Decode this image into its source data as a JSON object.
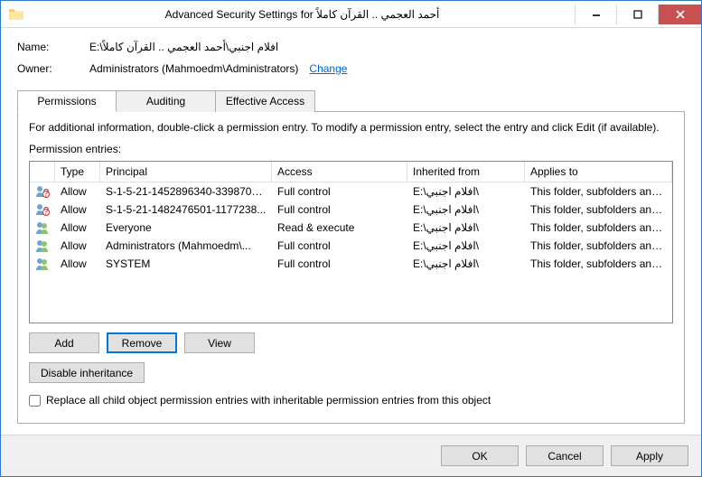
{
  "titlebar": {
    "title": "Advanced Security Settings for أحمد العجمي .. القرآن كاملاً"
  },
  "labels": {
    "name": "Name:",
    "owner": "Owner:"
  },
  "name_value": "E:\\افلام اجنبي\\أحمد العجمي .. القرآن كاملاً",
  "owner_value": "Administrators (Mahmoedm\\Administrators)",
  "change_link": "Change",
  "tabs": {
    "permissions": "Permissions",
    "auditing": "Auditing",
    "effective": "Effective Access"
  },
  "info_text": "For additional information, double-click a permission entry. To modify a permission entry, select the entry and click Edit (if available).",
  "entries_label": "Permission entries:",
  "headers": {
    "type": "Type",
    "principal": "Principal",
    "access": "Access",
    "inherited": "Inherited from",
    "applies": "Applies to"
  },
  "rows": [
    {
      "icon": "unknown",
      "type": "Allow",
      "principal": "S-1-5-21-1452896340-3398700...",
      "access": "Full control",
      "inherited": "E:\\افلام اجنبي\\",
      "applies": "This folder, subfolders and files"
    },
    {
      "icon": "unknown",
      "type": "Allow",
      "principal": "S-1-5-21-1482476501-1177238...",
      "access": "Full control",
      "inherited": "E:\\افلام اجنبي\\",
      "applies": "This folder, subfolders and files"
    },
    {
      "icon": "group",
      "type": "Allow",
      "principal": "Everyone",
      "access": "Read & execute",
      "inherited": "E:\\افلام اجنبي\\",
      "applies": "This folder, subfolders and files"
    },
    {
      "icon": "group",
      "type": "Allow",
      "principal": "Administrators (Mahmoedm\\...",
      "access": "Full control",
      "inherited": "E:\\افلام اجنبي\\",
      "applies": "This folder, subfolders and files"
    },
    {
      "icon": "group",
      "type": "Allow",
      "principal": "SYSTEM",
      "access": "Full control",
      "inherited": "E:\\افلام اجنبي\\",
      "applies": "This folder, subfolders and files"
    }
  ],
  "buttons": {
    "add": "Add",
    "remove": "Remove",
    "view": "View",
    "disable": "Disable inheritance",
    "ok": "OK",
    "cancel": "Cancel",
    "apply": "Apply"
  },
  "checkbox_label": "Replace all child object permission entries with inheritable permission entries from this object"
}
